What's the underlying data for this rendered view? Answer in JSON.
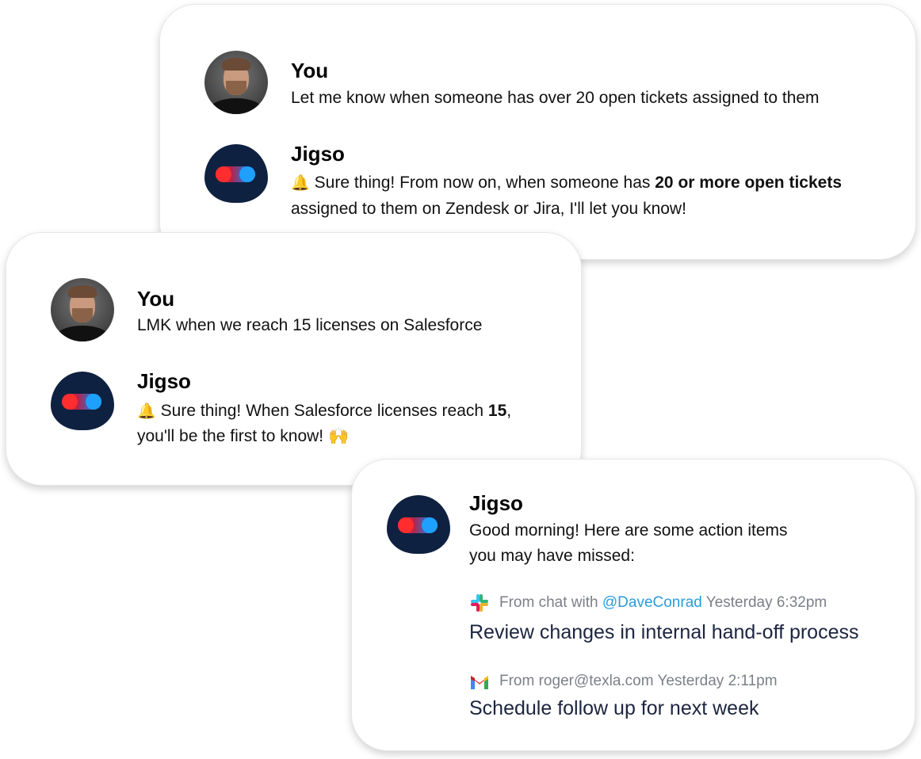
{
  "card1": {
    "user_name": "You",
    "user_message": "Let me know when someone has over 20 open tickets assigned to them",
    "bot_name": "Jigso",
    "bot_icon": "bell-icon",
    "bot_text_1": "Sure thing! From now on, when someone has ",
    "bot_text_bold": "20 or more open tickets",
    "bot_text_2": "assigned to them on Zendesk or Jira, I'll let you know!"
  },
  "card2": {
    "user_name": "You",
    "user_message": "LMK when we reach 15 licenses on Salesforce",
    "bot_name": "Jigso",
    "bot_icon": "bell-icon",
    "bot_text_1": "Sure thing! When Salesforce licenses reach ",
    "bot_text_bold": "15",
    "bot_text_after_bold": ",",
    "bot_text_2": "you'll be the first to know!",
    "bot_emoji": "🙌"
  },
  "card3": {
    "bot_name": "Jigso",
    "greeting_line1": "Good morning! Here are some action items",
    "greeting_line2": "you may have missed:",
    "items": [
      {
        "icon": "slack-icon",
        "source_prefix": "From chat with ",
        "mention": "@DaveConrad",
        "time": " Yesterday 6:32pm",
        "task": "Review changes in internal hand-off process"
      },
      {
        "icon": "gmail-icon",
        "source_prefix": "From roger@texla.com",
        "time": " Yesterday 2:11pm",
        "task": "Schedule follow up for next week"
      }
    ]
  },
  "colors": {
    "bot_bg": "#0f2140",
    "bot_red": "#ff2d2d",
    "bot_blue": "#1ea0ff",
    "mention": "#2a9cdc",
    "muted": "#7b7f87",
    "task": "#1c2540"
  }
}
